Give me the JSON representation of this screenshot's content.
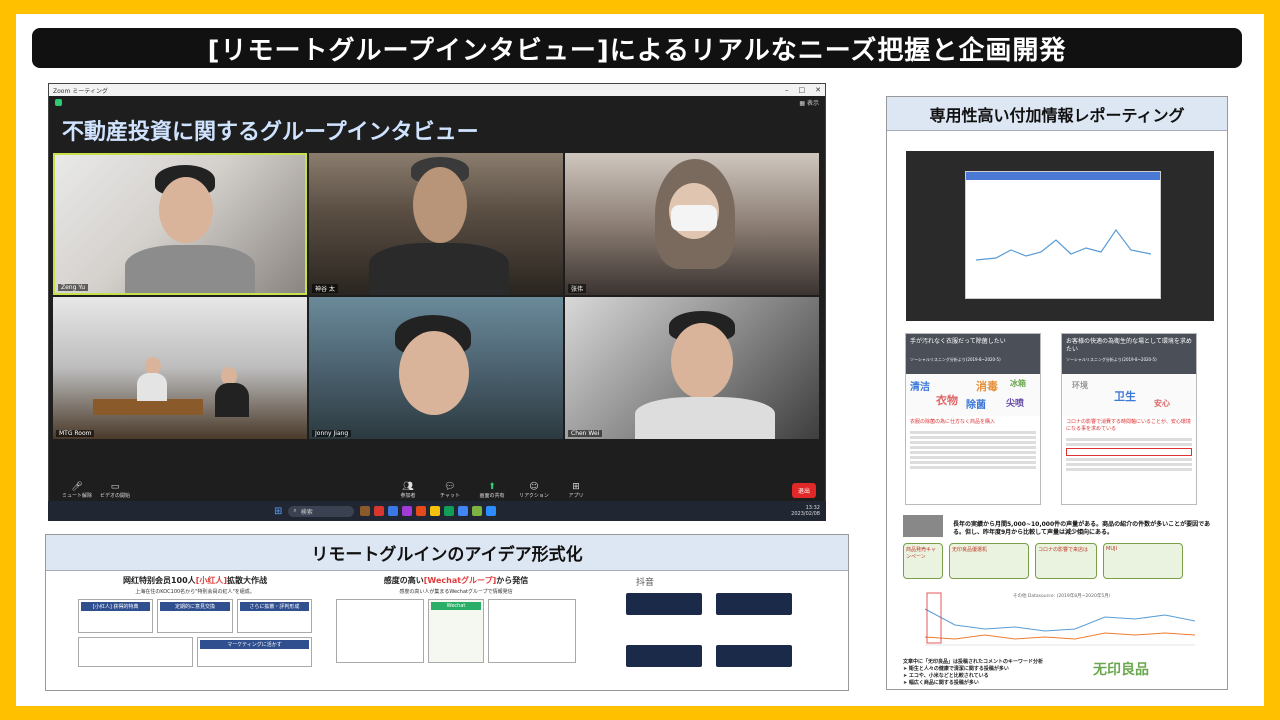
{
  "slide_title": "[リモートグループインタビュー]によるリアルなニーズ把握と企画開発",
  "zoom": {
    "app_title": "Zoom ミーティング",
    "view_label": "表示",
    "heading": "不動産投資に関するグループインタビュー",
    "participants": [
      {
        "name": "Zeng Yu"
      },
      {
        "name": "神谷 太"
      },
      {
        "name": "张伟"
      },
      {
        "name": "MTG Room"
      },
      {
        "name": "Jonny Jiang"
      },
      {
        "name": "Chen Wei"
      }
    ],
    "toolbar": {
      "mute": "ミュート解除",
      "video": "ビデオの開始",
      "participants": "参加者",
      "participants_count": "6",
      "chat": "チャット",
      "share": "画面の共有",
      "reactions": "リアクション",
      "apps": "アプリ",
      "end": "退出"
    },
    "taskbar": {
      "search": "検索",
      "time": "13:32",
      "date": "2023/02/08"
    }
  },
  "idea_panel": {
    "title": "リモートグルインのアイデア形式化",
    "card1": {
      "title_pre": "网红特别会员100人",
      "title_highlight": "[小红人]",
      "title_post": "拡散大作战",
      "line1": "上海在住のKOC100名から\"特別会員の紅人\"を組成。",
      "boxes": [
        "[小红人] 获得的特典",
        "定期的に意見交換",
        "さらに拡散・評判形成"
      ],
      "footer": "マーケティングに活かす"
    },
    "card2": {
      "title_pre": "感度の高い",
      "title_highlight": "[Wechatグループ]",
      "title_post": "から発信",
      "line1": "感度の高い人が集まるWechatグループで情報発信",
      "box": "Wechat"
    },
    "card3": {
      "title": "抖音"
    }
  },
  "report_panel": {
    "title": "専用性高い付加情報レポーティング",
    "wordcloud_left": {
      "heading": "手が汚れなく衣服だって除菌したい",
      "sub": "ソーシャルリスニング分析より(2019-8~2020-5)",
      "words": [
        "清洁",
        "衣物",
        "消毒",
        "除菌",
        "冰箱",
        "尖喷"
      ],
      "red_note": "衣服の除菌の為に仕方なく商品を購入"
    },
    "wordcloud_right": {
      "heading": "お客様の快適の為衛生的な場として環境を求めたい",
      "sub": "ソーシャルリスニング分析より(2019-8~2020-5)",
      "words": [
        "环境",
        "卫生",
        "安心"
      ],
      "red_note": "コロナの影響で消費する時間軸にいることが、安心環境になる事を求めている"
    },
    "summary": "長年の実績から月間5,000~10,000件の声量がある。商品の紹介の件数が多いことが要因である。但し、昨年度9月から比較して声量は減少傾向にある。",
    "cards": [
      "商品発売キャンペーン",
      "无印良品優選机",
      "コロナの影響で来店は",
      "MUJI"
    ],
    "notes": [
      "文章中に「无印良品」は投稿されたコメントのキーワード分析",
      "➤ 衛生と人々の健康で清潔に関する投稿が多い",
      "➤ エコや、小米などと比較されている",
      "➤ 幅広く商品に関する投稿が多い"
    ],
    "chart_note": "その他 Datasource: (2019年8月~2020年5月)",
    "brand_word": "无印良品"
  },
  "colors": {
    "frame": "#FFC000",
    "title_bg": "#111111",
    "panel_head": "#dde6f3",
    "zoom_heading": "#cfe3ff",
    "end_button": "#e02828"
  }
}
